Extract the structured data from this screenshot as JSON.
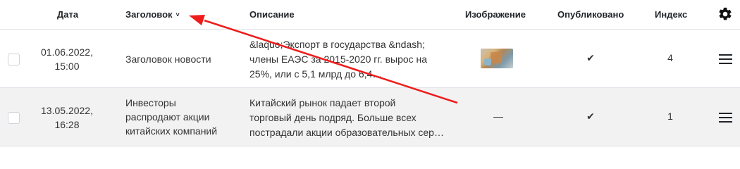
{
  "header": {
    "date": "Дата",
    "title": "Заголовок",
    "title_sort": "˅",
    "description": "Описание",
    "image": "Изображение",
    "published": "Опубликовано",
    "index": "Индекс"
  },
  "rows": [
    {
      "date_line1": "01.06.2022,",
      "date_line2": "15:00",
      "title": "Заголовок новости",
      "desc_line1": "&laquo;Экспорт в государства &ndash;",
      "desc_line2": "члены ЕАЭС за 2015-2020 гг. вырос на",
      "desc_line3": "25%, или с 5,1 млрд до 6,4…",
      "published": "✔",
      "index": "4"
    },
    {
      "date_line1": "13.05.2022,",
      "date_line2": "16:28",
      "title_line1": "Инвесторы",
      "title_line2": "распродают акции",
      "title_line3": "китайских компаний",
      "desc_line1": "Китайский рынок падает второй",
      "desc_line2": "торговый день подряд. Больше всех",
      "desc_line3": "пострадали акции образовательных сер…",
      "image": "—",
      "published": "✔",
      "index": "1"
    }
  ],
  "colors": {
    "annotation_arrow": "#ee1c1c"
  },
  "icons": {
    "settings": "gear-icon",
    "drag": "drag-handle-icon",
    "sort": "chevron-down-icon"
  }
}
